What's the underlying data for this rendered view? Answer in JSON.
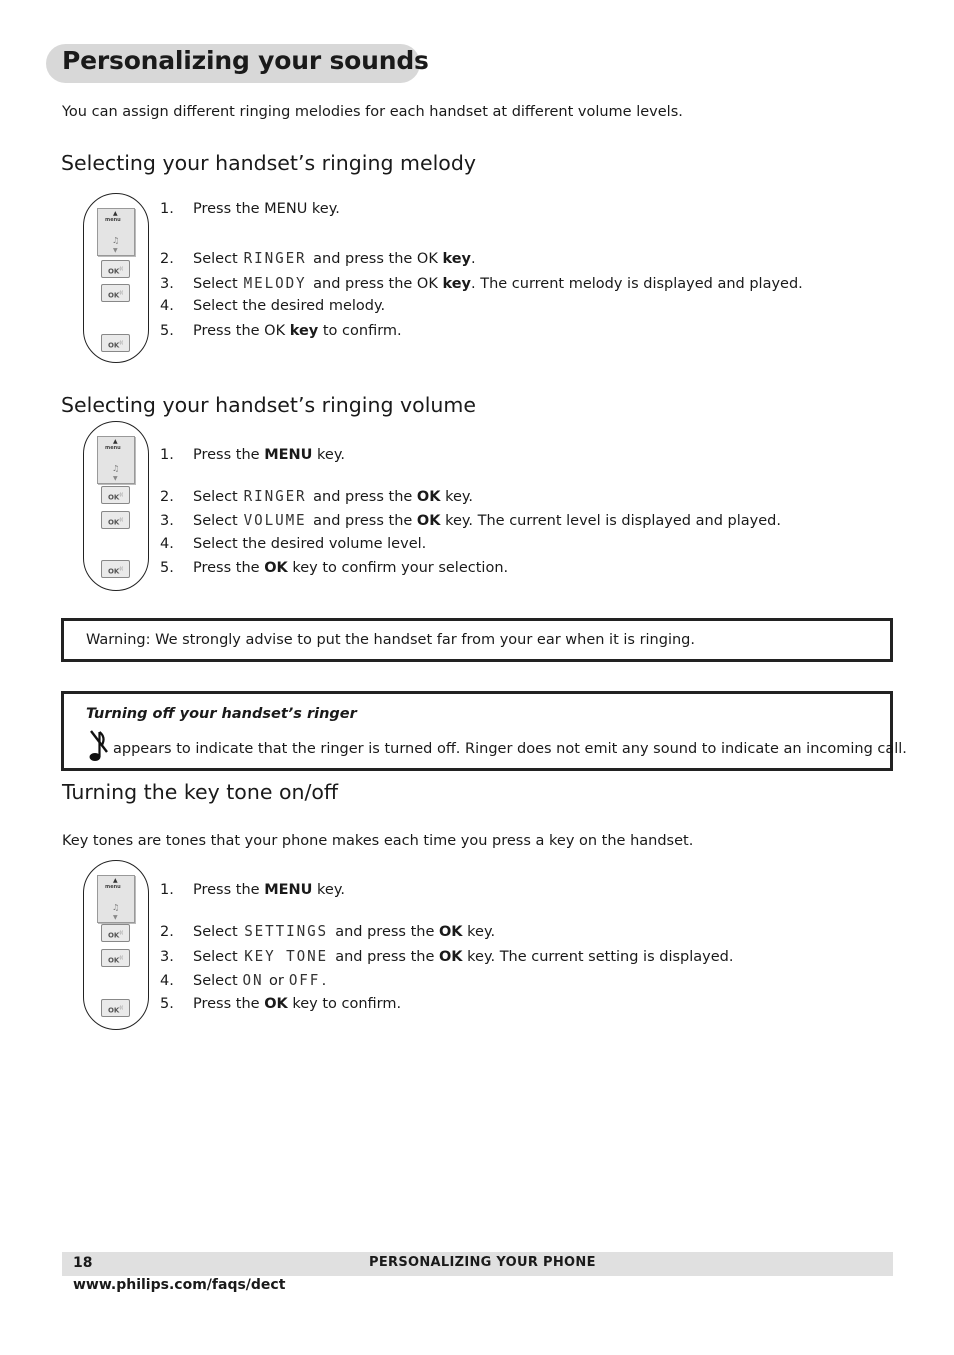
{
  "page_title": "Personalizing your sounds",
  "intro": "You can assign different ringing melodies for each handset at different volume levels.",
  "sections": [
    {
      "heading": "Selecting your handset’s ringing melody",
      "steps": [
        {
          "num": "1.",
          "pre": "Press the MENU key.",
          "lcd": "",
          "mid": "",
          "bold": "",
          "post": ""
        },
        {
          "num": "2.",
          "pre": "Select ",
          "lcd": "RINGER",
          "mid": " and press the OK ",
          "bold": "key",
          "post": "."
        },
        {
          "num": "3.",
          "pre": "Select ",
          "lcd": "MELODY",
          "mid": " and press the OK ",
          "bold": "key",
          "post": ".  The current melody is displayed and played."
        },
        {
          "num": "4.",
          "pre": "Select the desired melody.",
          "lcd": "",
          "mid": "",
          "bold": "",
          "post": ""
        },
        {
          "num": "5.",
          "pre": "Press the OK ",
          "lcd": "",
          "mid": "",
          "bold": "key",
          "post": " to confirm."
        }
      ]
    },
    {
      "heading": "Selecting your handset’s ringing volume",
      "steps": [
        {
          "num": "1.",
          "pre": "Press the ",
          "lcd": "",
          "mid": "",
          "bold": "MENU",
          "post": " key."
        },
        {
          "num": "2.",
          "pre": "Select ",
          "lcd": "RINGER",
          "mid": " and press the ",
          "bold": "OK",
          "post": " key."
        },
        {
          "num": "3.",
          "pre": "Select ",
          "lcd": "VOLUME",
          "mid": " and press the ",
          "bold": "OK",
          "post": " key.  The current level is displayed and played."
        },
        {
          "num": "4.",
          "pre": "Select the desired volume level.",
          "lcd": "",
          "mid": "",
          "bold": "",
          "post": ""
        },
        {
          "num": "5.",
          "pre": "Press the ",
          "lcd": "",
          "mid": "",
          "bold": "OK",
          "post": " key to confirm your selection."
        }
      ]
    },
    {
      "heading": "Turning the key tone on/off",
      "intro": "Key tones are tones that your phone makes each time you press a key on the handset.",
      "steps": [
        {
          "num": "1.",
          "pre": "Press the ",
          "lcd": "",
          "mid": "",
          "bold": "MENU",
          "post": " key."
        },
        {
          "num": "2.",
          "pre": "Select ",
          "lcd": "SETTINGS",
          "mid": " and press the ",
          "bold": "OK",
          "post": " key."
        },
        {
          "num": "3.",
          "pre": "Select ",
          "lcd": "KEY TONE",
          "mid": " and press the ",
          "bold": "OK",
          "post": " key.  The current setting is displayed."
        },
        {
          "num": "4.",
          "pre": "Select ",
          "lcd": "ON",
          "mid": " or ",
          "bold": "",
          "post": "",
          "lcd2": "OFF",
          "post2": "."
        },
        {
          "num": "5.",
          "pre": "Press the ",
          "lcd": "",
          "mid": "",
          "bold": "OK",
          "post": " key to confirm."
        }
      ]
    }
  ],
  "phone_diagram": {
    "screen_label": "menu",
    "ok_label": "OK",
    "icons": [
      "up-arrow-icon",
      "bell-icon",
      "down-arrow-icon"
    ]
  },
  "warning": "Warning:  We strongly advise to put the handset far from your ear when it is ringing.",
  "ringer_note": {
    "title": "Turning off your handset’s ringer",
    "icon": "ringer-off-icon",
    "text": "appears to indicate that the ringer is turned off.  Ringer does not emit any sound to indicate an incoming call."
  },
  "footer": {
    "page_number": "18",
    "section": "PERSONALIZING YOUR PHONE",
    "url": "www.philips.com/faqs/dect"
  }
}
